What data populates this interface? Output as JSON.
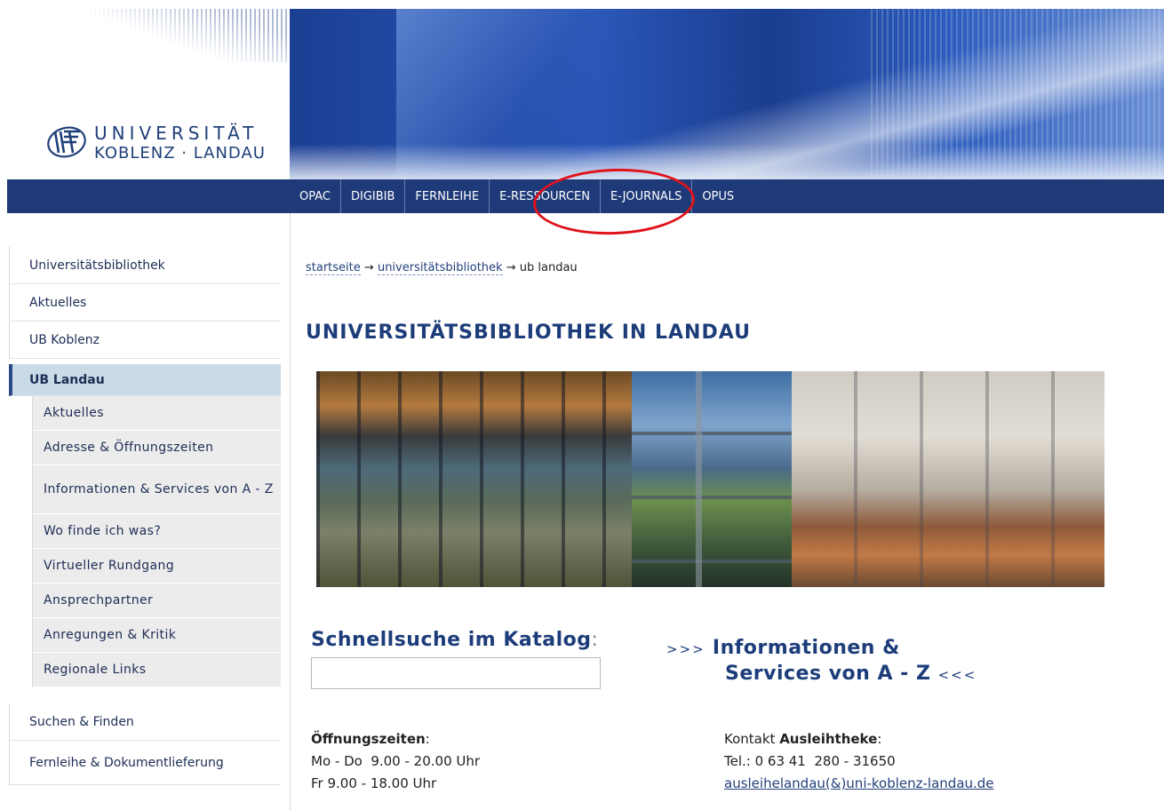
{
  "logo": {
    "line1": "UNIVERSITÄT",
    "line2": "KOBLENZ · LANDAU",
    "icon": "university-logo-icon"
  },
  "nav": {
    "items": [
      "OPAC",
      "DIGIBIB",
      "FERNLEIHE",
      "E-RESSOURCEN",
      "E-JOURNALS",
      "OPUS"
    ],
    "highlighted": "E-RESSOURCEN",
    "highlight_color": "#e0121a"
  },
  "sidebar": {
    "top_items": [
      "Universitätsbibliothek",
      "Aktuelles",
      "UB Koblenz"
    ],
    "active": "UB Landau",
    "sub_items": [
      "Aktuelles",
      "Adresse & Öffnungszeiten",
      "Informationen & Services von A - Z",
      "Wo finde ich was?",
      "Virtueller Rundgang",
      "Ansprechpartner",
      "Anregungen & Kritik",
      "Regionale Links"
    ],
    "bottom_items": [
      "Suchen & Finden",
      "Fernleihe & Dokumentlieferung"
    ]
  },
  "breadcrumb": {
    "items": [
      "startseite",
      "universitätsbibliothek"
    ],
    "separator": "→",
    "current": "ub landau"
  },
  "main": {
    "title": "UNIVERSITÄTSBIBLIOTHEK IN LANDAU",
    "quick_search": {
      "title": "Schnellsuche im Katalog",
      "colon": ":",
      "value": "",
      "placeholder": ""
    },
    "info_link": {
      "prefix": ">>>",
      "line1": "Informationen &",
      "line2": "Services von A - Z",
      "suffix": "<<<"
    },
    "hours": {
      "heading": "Öffnungszeiten",
      "colon": ":",
      "line1": "Mo - Do  9.00 - 20.00 Uhr",
      "line2": "Fr 9.00 - 18.00 Uhr"
    },
    "contact": {
      "prefix": "Kontakt ",
      "heading": "Ausleihtheke",
      "colon": ":",
      "tel": "Tel.: 0 63 41  280 - 31650",
      "email": "ausleihelandau(&)uni-koblenz-landau.de"
    }
  },
  "colors": {
    "nav_bg": "#1f3a78",
    "accent": "#1d3d7a",
    "active_bg": "#c9dbe7"
  }
}
